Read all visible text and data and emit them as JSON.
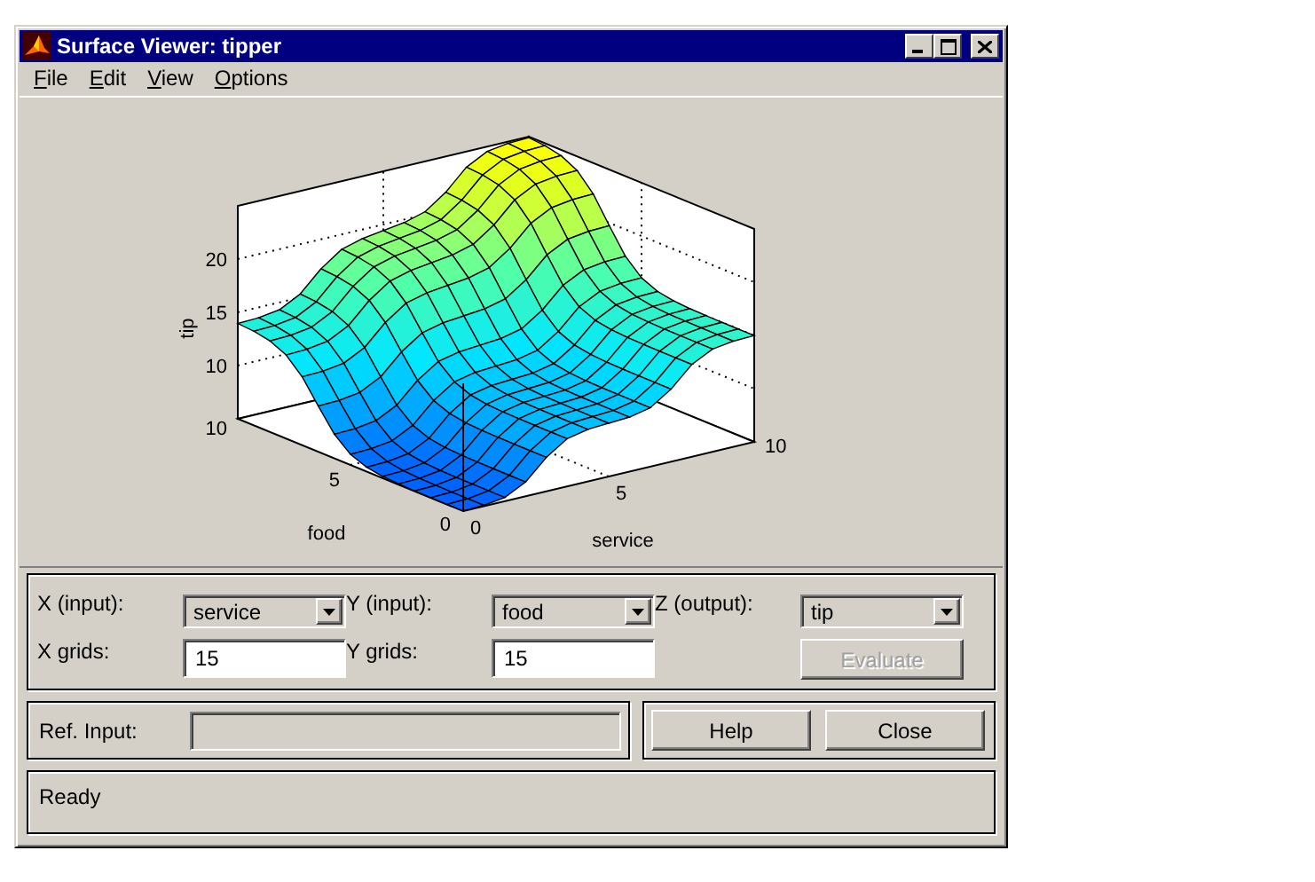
{
  "window": {
    "title": "Surface Viewer: tipper"
  },
  "menu": [
    {
      "label": "File"
    },
    {
      "label": "Edit"
    },
    {
      "label": "View"
    },
    {
      "label": "Options"
    }
  ],
  "plot": {
    "z_label": "tip",
    "x_label": "service",
    "y_label": "food",
    "z_ticks": [
      "20",
      "15",
      "10"
    ],
    "x_ticks": [
      "0",
      "5",
      "10"
    ],
    "y_ticks": [
      "0",
      "5",
      "10"
    ]
  },
  "controls": {
    "selectors": [
      {
        "label": "X (input):",
        "value": "service"
      },
      {
        "label": "Y (input):",
        "value": "food"
      },
      {
        "label": "Z (output):",
        "value": "tip"
      }
    ],
    "grids": [
      {
        "label": "X grids:",
        "value": "15"
      },
      {
        "label": "Y grids:",
        "value": "15"
      }
    ],
    "evaluate_button": {
      "label": "Evaluate",
      "disabled": true
    },
    "ref_input": {
      "label": "Ref. Input:",
      "disabled": true
    },
    "buttons": [
      {
        "label": "Help"
      },
      {
        "label": "Close"
      }
    ]
  },
  "status_bar": {
    "text": "Ready"
  }
}
